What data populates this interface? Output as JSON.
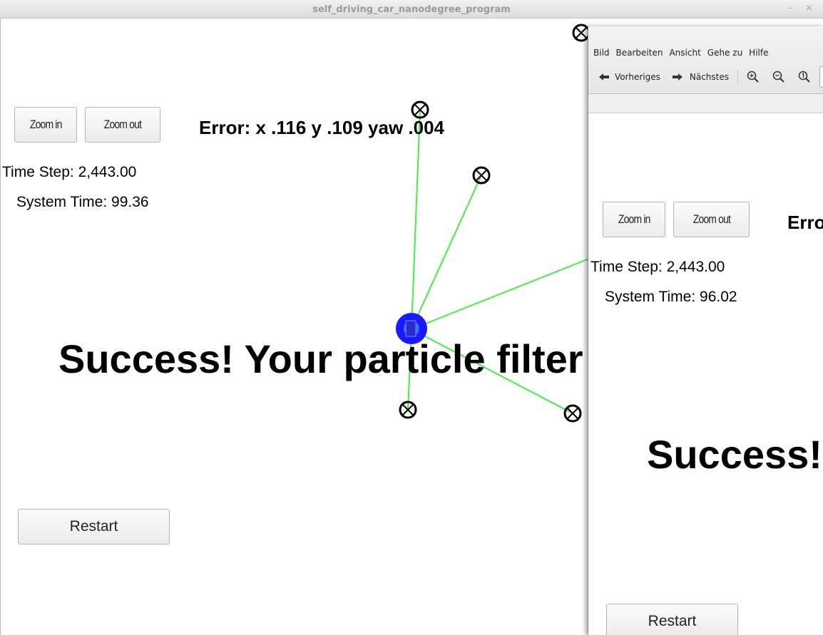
{
  "window": {
    "title": "self_driving_car_nanodegree_program",
    "minimize_label": "–",
    "close_label": "×"
  },
  "simulator": {
    "zoom_in_label": "Zoom in",
    "zoom_out_label": "Zoom out",
    "error_text": "Error: x .116 y .109 yaw .004",
    "time_step_text": "Time Step: 2,443.00",
    "system_time_text": "System Time: 99.36",
    "success_text": "Success! Your particle filter",
    "restart_label": "Restart",
    "colors": {
      "observation_line": "#44ee44",
      "car": "#1a1aff",
      "landmark": "#000000"
    }
  },
  "viewer": {
    "menu": [
      "Bild",
      "Bearbeiten",
      "Ansicht",
      "Gehe zu",
      "Hilfe"
    ],
    "toolbar": {
      "previous_label": "Vorheriges",
      "next_label": "Nächstes"
    },
    "screenshot": {
      "zoom_in_label": "Zoom in",
      "zoom_out_label": "Zoom out",
      "error_text": "Erro",
      "time_step_text": "Time Step: 2,443.00",
      "system_time_text": "System Time: 96.02",
      "success_text": "Success!",
      "restart_label": "Restart"
    }
  }
}
